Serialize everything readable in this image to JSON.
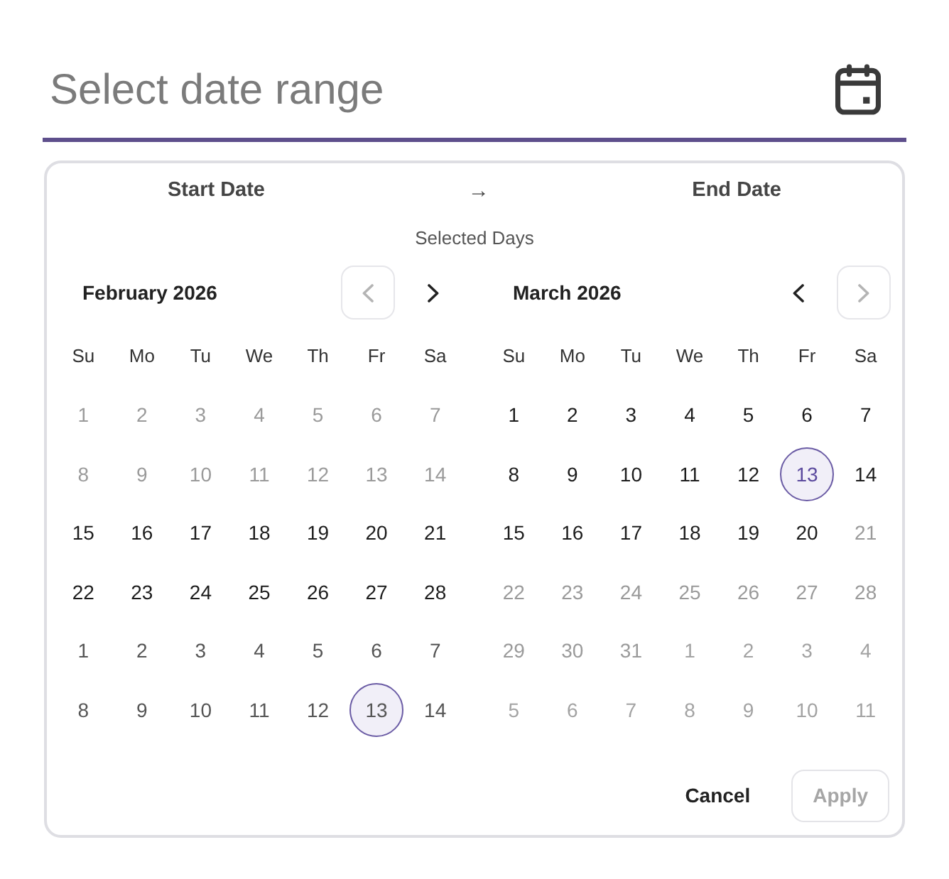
{
  "field": {
    "placeholder": "Select date range"
  },
  "picker": {
    "start_label": "Start Date",
    "arrow": "→",
    "end_label": "End Date",
    "subtitle": "Selected Days",
    "months": [
      {
        "title": "February 2026",
        "prev": {
          "disabled": true
        },
        "next": {
          "disabled": false
        },
        "weekdays": [
          "Su",
          "Mo",
          "Tu",
          "We",
          "Th",
          "Fr",
          "Sa"
        ],
        "days": [
          {
            "text": "1",
            "disabled": true,
            "outside": false,
            "today": false
          },
          {
            "text": "2",
            "disabled": true,
            "outside": false,
            "today": false
          },
          {
            "text": "3",
            "disabled": true,
            "outside": false,
            "today": false
          },
          {
            "text": "4",
            "disabled": true,
            "outside": false,
            "today": false
          },
          {
            "text": "5",
            "disabled": true,
            "outside": false,
            "today": false
          },
          {
            "text": "6",
            "disabled": true,
            "outside": false,
            "today": false
          },
          {
            "text": "7",
            "disabled": true,
            "outside": false,
            "today": false
          },
          {
            "text": "8",
            "disabled": true,
            "outside": false,
            "today": false
          },
          {
            "text": "9",
            "disabled": true,
            "outside": false,
            "today": false
          },
          {
            "text": "10",
            "disabled": true,
            "outside": false,
            "today": false
          },
          {
            "text": "11",
            "disabled": true,
            "outside": false,
            "today": false
          },
          {
            "text": "12",
            "disabled": true,
            "outside": false,
            "today": false
          },
          {
            "text": "13",
            "disabled": true,
            "outside": false,
            "today": false
          },
          {
            "text": "14",
            "disabled": true,
            "outside": false,
            "today": false
          },
          {
            "text": "15",
            "disabled": false,
            "outside": false,
            "today": false
          },
          {
            "text": "16",
            "disabled": false,
            "outside": false,
            "today": false
          },
          {
            "text": "17",
            "disabled": false,
            "outside": false,
            "today": false
          },
          {
            "text": "18",
            "disabled": false,
            "outside": false,
            "today": false
          },
          {
            "text": "19",
            "disabled": false,
            "outside": false,
            "today": false
          },
          {
            "text": "20",
            "disabled": false,
            "outside": false,
            "today": false
          },
          {
            "text": "21",
            "disabled": false,
            "outside": false,
            "today": false
          },
          {
            "text": "22",
            "disabled": false,
            "outside": false,
            "today": false
          },
          {
            "text": "23",
            "disabled": false,
            "outside": false,
            "today": false
          },
          {
            "text": "24",
            "disabled": false,
            "outside": false,
            "today": false
          },
          {
            "text": "25",
            "disabled": false,
            "outside": false,
            "today": false
          },
          {
            "text": "26",
            "disabled": false,
            "outside": false,
            "today": false
          },
          {
            "text": "27",
            "disabled": false,
            "outside": false,
            "today": false
          },
          {
            "text": "28",
            "disabled": false,
            "outside": false,
            "today": false
          },
          {
            "text": "1",
            "disabled": false,
            "outside": true,
            "today": false
          },
          {
            "text": "2",
            "disabled": false,
            "outside": true,
            "today": false
          },
          {
            "text": "3",
            "disabled": false,
            "outside": true,
            "today": false
          },
          {
            "text": "4",
            "disabled": false,
            "outside": true,
            "today": false
          },
          {
            "text": "5",
            "disabled": false,
            "outside": true,
            "today": false
          },
          {
            "text": "6",
            "disabled": false,
            "outside": true,
            "today": false
          },
          {
            "text": "7",
            "disabled": false,
            "outside": true,
            "today": false
          },
          {
            "text": "8",
            "disabled": false,
            "outside": true,
            "today": false
          },
          {
            "text": "9",
            "disabled": false,
            "outside": true,
            "today": false
          },
          {
            "text": "10",
            "disabled": false,
            "outside": true,
            "today": false
          },
          {
            "text": "11",
            "disabled": false,
            "outside": true,
            "today": false
          },
          {
            "text": "12",
            "disabled": false,
            "outside": true,
            "today": false
          },
          {
            "text": "13",
            "disabled": false,
            "outside": true,
            "today": true
          },
          {
            "text": "14",
            "disabled": false,
            "outside": true,
            "today": false
          }
        ]
      },
      {
        "title": "March 2026",
        "prev": {
          "disabled": false
        },
        "next": {
          "disabled": true
        },
        "weekdays": [
          "Su",
          "Mo",
          "Tu",
          "We",
          "Th",
          "Fr",
          "Sa"
        ],
        "days": [
          {
            "text": "1",
            "disabled": false,
            "outside": false,
            "today": false
          },
          {
            "text": "2",
            "disabled": false,
            "outside": false,
            "today": false
          },
          {
            "text": "3",
            "disabled": false,
            "outside": false,
            "today": false
          },
          {
            "text": "4",
            "disabled": false,
            "outside": false,
            "today": false
          },
          {
            "text": "5",
            "disabled": false,
            "outside": false,
            "today": false
          },
          {
            "text": "6",
            "disabled": false,
            "outside": false,
            "today": false
          },
          {
            "text": "7",
            "disabled": false,
            "outside": false,
            "today": false
          },
          {
            "text": "8",
            "disabled": false,
            "outside": false,
            "today": false
          },
          {
            "text": "9",
            "disabled": false,
            "outside": false,
            "today": false
          },
          {
            "text": "10",
            "disabled": false,
            "outside": false,
            "today": false
          },
          {
            "text": "11",
            "disabled": false,
            "outside": false,
            "today": false
          },
          {
            "text": "12",
            "disabled": false,
            "outside": false,
            "today": false
          },
          {
            "text": "13",
            "disabled": false,
            "outside": false,
            "today": true
          },
          {
            "text": "14",
            "disabled": false,
            "outside": false,
            "today": false
          },
          {
            "text": "15",
            "disabled": false,
            "outside": false,
            "today": false
          },
          {
            "text": "16",
            "disabled": false,
            "outside": false,
            "today": false
          },
          {
            "text": "17",
            "disabled": false,
            "outside": false,
            "today": false
          },
          {
            "text": "18",
            "disabled": false,
            "outside": false,
            "today": false
          },
          {
            "text": "19",
            "disabled": false,
            "outside": false,
            "today": false
          },
          {
            "text": "20",
            "disabled": false,
            "outside": false,
            "today": false
          },
          {
            "text": "21",
            "disabled": true,
            "outside": false,
            "today": false
          },
          {
            "text": "22",
            "disabled": true,
            "outside": false,
            "today": false
          },
          {
            "text": "23",
            "disabled": true,
            "outside": false,
            "today": false
          },
          {
            "text": "24",
            "disabled": true,
            "outside": false,
            "today": false
          },
          {
            "text": "25",
            "disabled": true,
            "outside": false,
            "today": false
          },
          {
            "text": "26",
            "disabled": true,
            "outside": false,
            "today": false
          },
          {
            "text": "27",
            "disabled": true,
            "outside": false,
            "today": false
          },
          {
            "text": "28",
            "disabled": true,
            "outside": false,
            "today": false
          },
          {
            "text": "29",
            "disabled": true,
            "outside": false,
            "today": false
          },
          {
            "text": "30",
            "disabled": true,
            "outside": false,
            "today": false
          },
          {
            "text": "31",
            "disabled": true,
            "outside": false,
            "today": false
          },
          {
            "text": "1",
            "disabled": true,
            "outside": true,
            "today": false
          },
          {
            "text": "2",
            "disabled": true,
            "outside": true,
            "today": false
          },
          {
            "text": "3",
            "disabled": true,
            "outside": true,
            "today": false
          },
          {
            "text": "4",
            "disabled": true,
            "outside": true,
            "today": false
          },
          {
            "text": "5",
            "disabled": true,
            "outside": true,
            "today": false
          },
          {
            "text": "6",
            "disabled": true,
            "outside": true,
            "today": false
          },
          {
            "text": "7",
            "disabled": true,
            "outside": true,
            "today": false
          },
          {
            "text": "8",
            "disabled": true,
            "outside": true,
            "today": false
          },
          {
            "text": "9",
            "disabled": true,
            "outside": true,
            "today": false
          },
          {
            "text": "10",
            "disabled": true,
            "outside": true,
            "today": false
          },
          {
            "text": "11",
            "disabled": true,
            "outside": true,
            "today": false
          }
        ]
      }
    ],
    "buttons": [
      {
        "label": "Cancel",
        "kind": "text",
        "disabled": false
      },
      {
        "label": "Apply",
        "kind": "outlined",
        "disabled": true
      }
    ]
  }
}
